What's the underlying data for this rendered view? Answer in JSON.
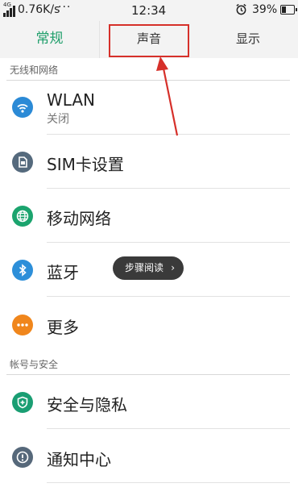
{
  "status_bar": {
    "network": "4G",
    "speed": "0.76K/s",
    "more": "···",
    "time": "12:34",
    "battery_percent": "39%",
    "battery_level": 0.39,
    "icons": [
      "signal-icon",
      "alarm-icon",
      "battery-icon"
    ]
  },
  "tabs": [
    {
      "label": "常规",
      "active": true
    },
    {
      "label": "声音",
      "active": false,
      "highlighted": true
    },
    {
      "label": "显示",
      "active": false
    }
  ],
  "sections": [
    {
      "header": "无线和网络",
      "items": [
        {
          "title": "WLAN",
          "subtitle": "关闭",
          "icon": "wifi-icon",
          "icon_color": "#2b8ad6"
        },
        {
          "title": "SIM卡设置",
          "icon": "sim-card-icon",
          "icon_color": "#556a7d"
        },
        {
          "title": "移动网络",
          "icon": "globe-icon",
          "icon_color": "#1ba46e"
        },
        {
          "title": "蓝牙",
          "icon": "bluetooth-icon",
          "icon_color": "#2d8fd9"
        },
        {
          "title": "更多",
          "icon": "more-icon",
          "icon_color": "#f0861c"
        }
      ]
    },
    {
      "header": "帐号与安全",
      "items": [
        {
          "title": "安全与隐私",
          "icon": "shield-icon",
          "icon_color": "#1a9e73"
        },
        {
          "title": "通知中心",
          "icon": "notification-icon",
          "icon_color": "#56687a"
        }
      ]
    }
  ],
  "tooltip": {
    "label": "步骤阅读",
    "chevron": "›"
  },
  "colors": {
    "accent": "#1e9e6a",
    "annotation": "#d6302a"
  }
}
